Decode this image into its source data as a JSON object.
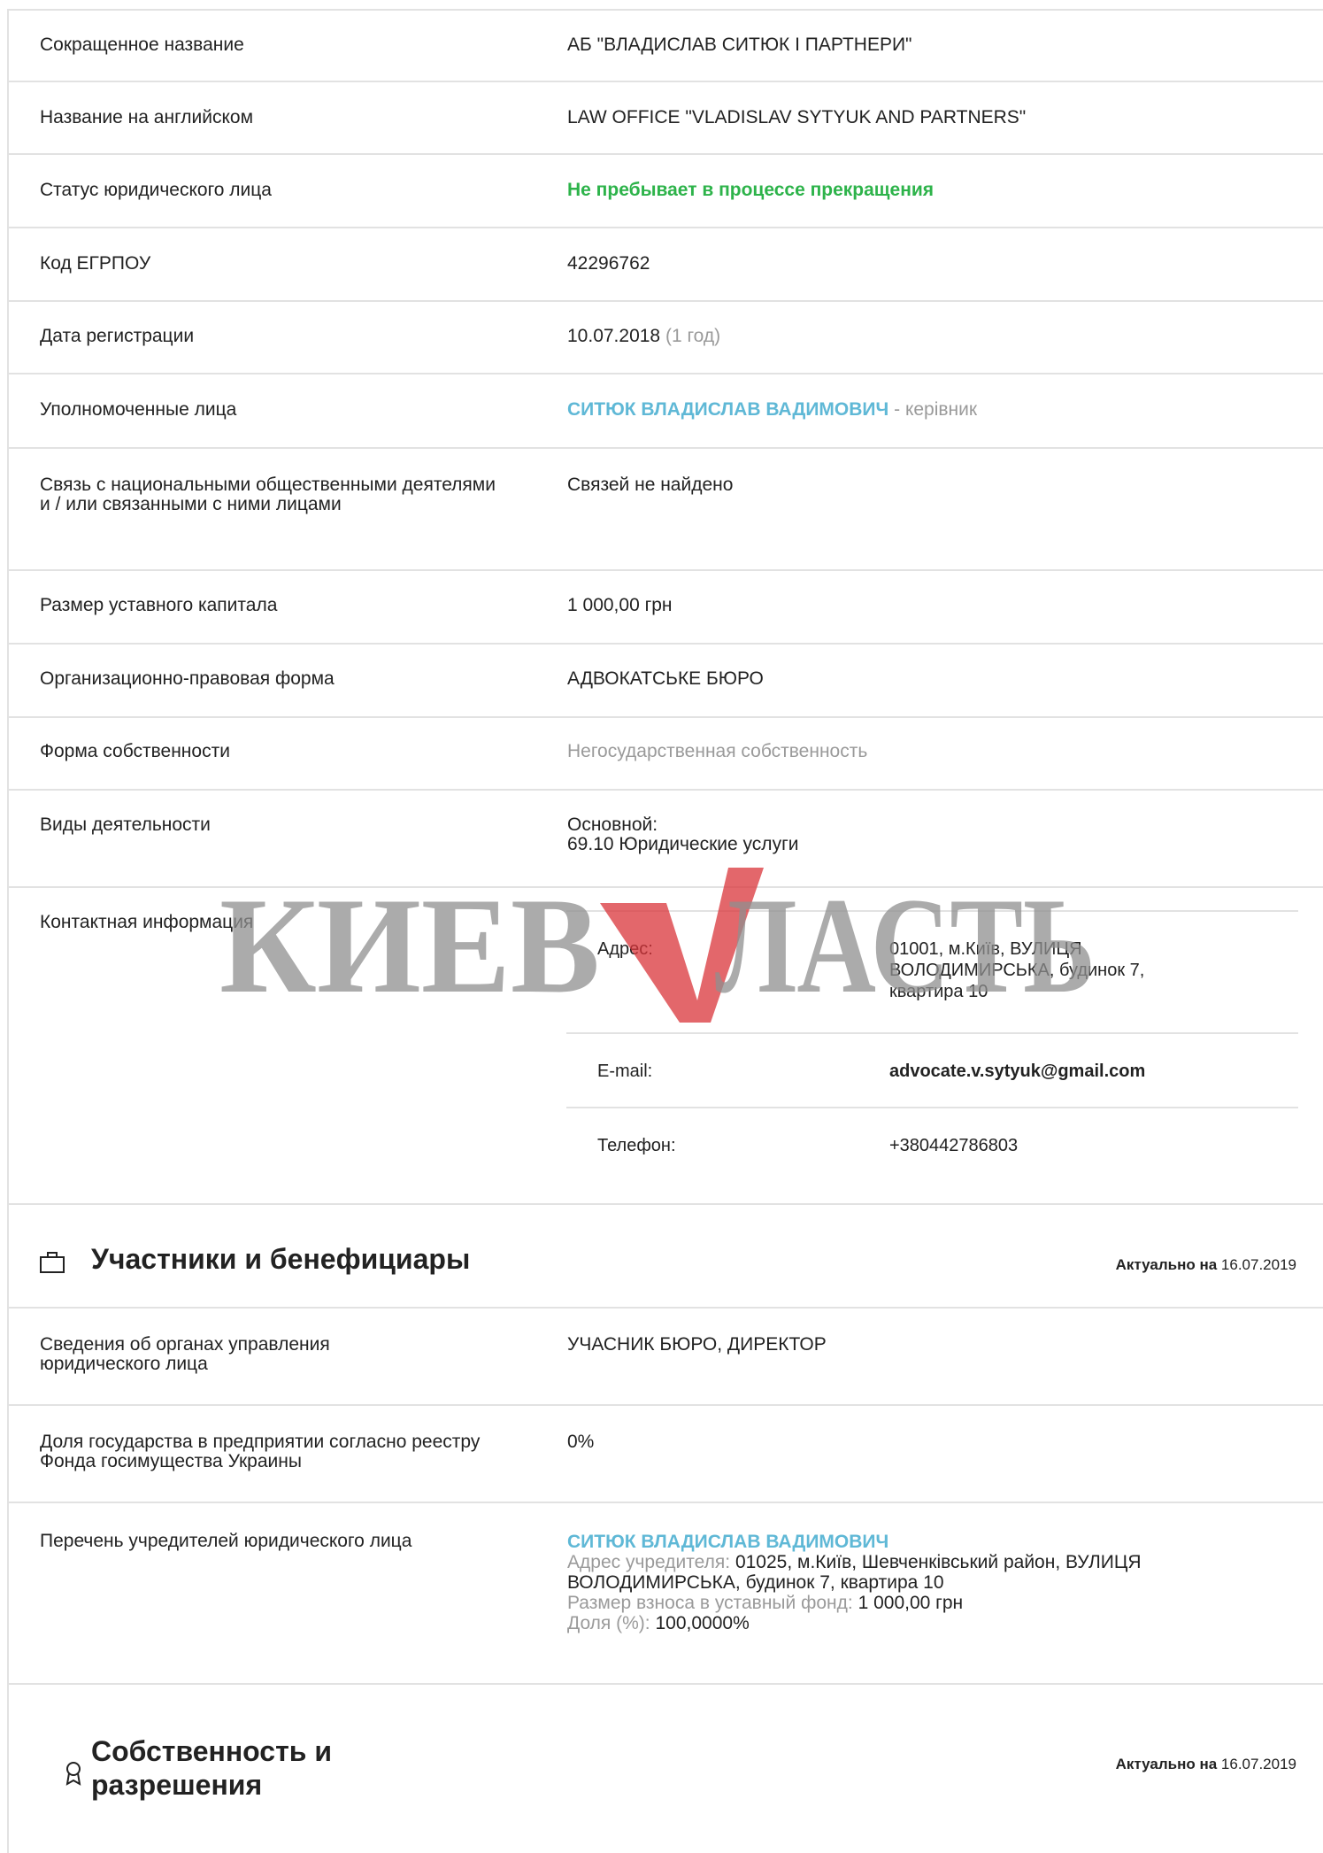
{
  "rows": {
    "short_name": {
      "label": "Сокращенное название",
      "value": "АБ \"ВЛАДИСЛАВ СИТЮК І ПАРТНЕРИ\""
    },
    "english_name": {
      "label": "Название на английском",
      "value": "LAW OFFICE \"VLADISLAV SYTYUK AND PARTNERS\""
    },
    "status": {
      "label": "Статус юридического лица",
      "value": "Не пребывает в процессе прекращения"
    },
    "code": {
      "label": "Код ЕГРПОУ",
      "value": "42296762"
    },
    "reg_date": {
      "label": "Дата регистрации",
      "value": "10.07.2018",
      "age": "(1 год)"
    },
    "authorized": {
      "label": "Уполномоченные лица",
      "person": "СИТЮК ВЛАДИСЛАВ ВАДИМОВИЧ",
      "role": "- керівник"
    },
    "connections": {
      "label": "Связь с национальными общественными деятелями и / или связанными с ними лицами",
      "value": "Связей не найдено"
    },
    "capital": {
      "label": "Размер уставного капитала",
      "value": "1 000,00 грн"
    },
    "legal_form": {
      "label": "Организационно-правовая форма",
      "value": "АДВОКАТСЬКЕ БЮРО"
    },
    "ownership": {
      "label": "Форма собственности",
      "value": "Негосударственная собственность"
    },
    "activities": {
      "label": "Виды деятельности",
      "kind": "Основной:",
      "value": "69.10 Юридические услуги"
    },
    "contacts": {
      "label": "Контактная информация",
      "address_label": "Адрес:",
      "address_value": "01001, м.Київ, ВУЛИЦЯ ВОЛОДИМИРСЬКА, будинок 7, квартира 10",
      "email_label": "E-mail:",
      "email_value": "advocate.v.sytyuk@gmail.com",
      "phone_label": "Телефон:",
      "phone_value": "+380442786803"
    }
  },
  "participants": {
    "title": "Участники и бенефициары",
    "actual_label": "Актуально на",
    "actual_date": "16.07.2019",
    "management": {
      "label": "Сведения об органах управления юридического лица",
      "value": "УЧАСНИК БЮРО, ДИРЕКТОР"
    },
    "state_share": {
      "label": "Доля государства в предприятии согласно реестру Фонда госимущества Украины",
      "value": "0%"
    },
    "founders": {
      "label": "Перечень учредителей юридического лица",
      "name": "СИТЮК ВЛАДИСЛАВ ВАДИМОВИЧ",
      "address_label": "Адрес учредителя:",
      "address_value": "01025, м.Київ, Шевченківський район, ВУЛИЦЯ ВОЛОДИМИРСЬКА, будинок 7, квартира 10",
      "contribution_label": "Размер взноса в уставный фонд:",
      "contribution_value": "1 000,00 грн",
      "share_label": "Доля (%):",
      "share_value": "100,0000%"
    }
  },
  "property": {
    "title": "Собственность и разрешения",
    "actual_label": "Актуально на",
    "actual_date": "16.07.2019"
  },
  "watermark": {
    "text_left": "КИЕВ",
    "text_right": "ЛАСТЬ"
  },
  "colors": {
    "green": "#2db34a",
    "link": "#5fb8d6",
    "muted": "#9a9a9a",
    "border": "#e2e2e2",
    "watermark_red": "#d9343a"
  }
}
